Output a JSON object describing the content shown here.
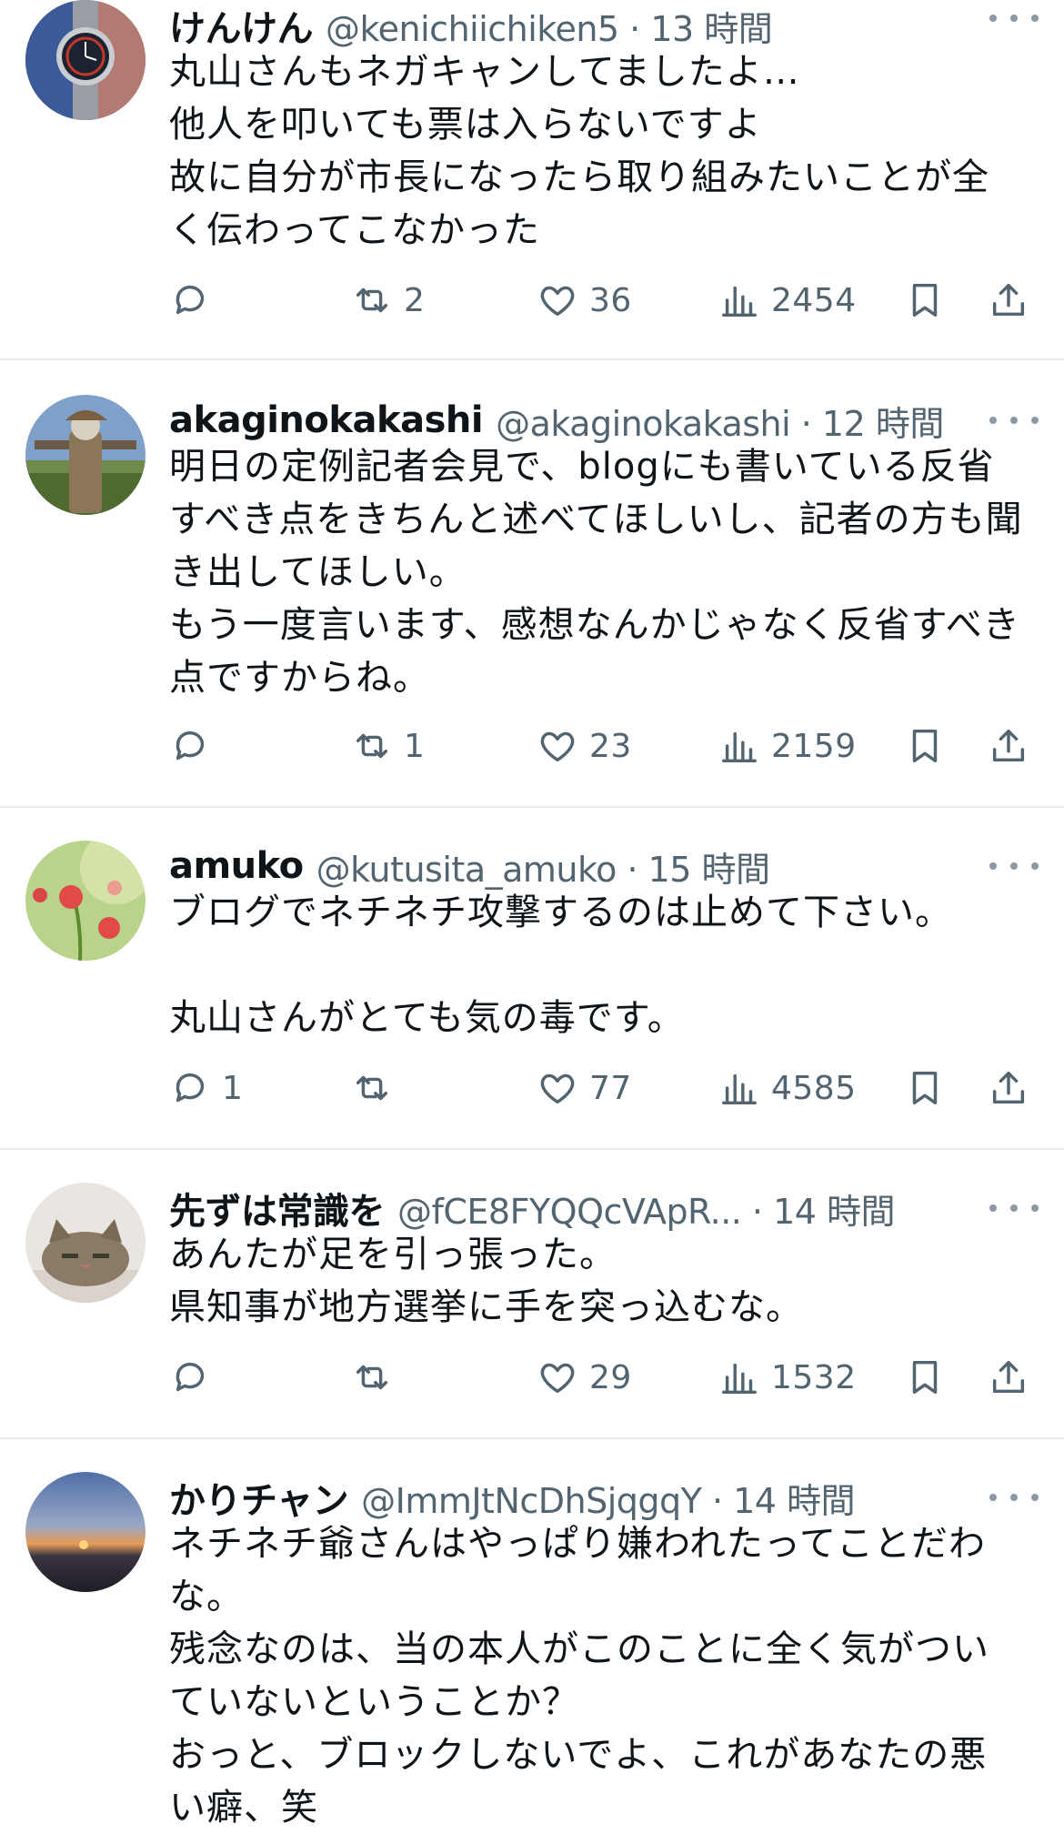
{
  "tweets": [
    {
      "name": "けんけん",
      "handle": "@kenichiichiken5 · 13 時間",
      "avatar": "watch-avatar",
      "body": "丸山さんもネガキャンしてましたよ…\n他人を叩いても票は入らないですよ\n故に自分が市長になったら取り組みたいことが全く伝わってこなかった",
      "replies": "",
      "retweets": "2",
      "likes": "36",
      "views": "2454"
    },
    {
      "name": "akaginokakashi",
      "handle": "@akaginokakashi · 12 時間",
      "avatar": "scarecrow-avatar",
      "body": "明日の定例記者会見で、blogにも書いている反省すべき点をきちんと述べてほしいし、記者の方も聞き出してほしい。\nもう一度言います、感想なんかじゃなく反省すべき点ですからね。",
      "replies": "",
      "retweets": "1",
      "likes": "23",
      "views": "2159"
    },
    {
      "name": "amuko",
      "handle": "@kutusita_amuko · 15 時間",
      "avatar": "flower-avatar",
      "body": "ブログでネチネチ攻撃するのは止めて下さい。\n\n丸山さんがとても気の毒です。",
      "replies": "1",
      "retweets": "",
      "likes": "77",
      "views": "4585"
    },
    {
      "name": "先ずは常識を",
      "handle": "@fCE8FYQQcVApR... · 14 時間",
      "avatar": "cat-avatar",
      "body": "あんたが足を引っ張った。\n県知事が地方選挙に手を突っ込むな。",
      "replies": "",
      "retweets": "",
      "likes": "29",
      "views": "1532"
    },
    {
      "name": "かりチャン",
      "handle": "@ImmJtNcDhSjqgqY · 14 時間",
      "avatar": "sunset-avatar",
      "body": "ネチネチ爺さんはやっぱり嫌われたってことだわな。\n残念なのは、当の本人がこのことに全く気がついていないということか？\nおっと、ブロックしないでよ、これがあなたの悪い癖、笑",
      "replies": "",
      "retweets": "",
      "likes": "",
      "views": ""
    }
  ],
  "colors": {
    "text": "#0f1419",
    "secondary": "#536471",
    "divider": "#e9ebed"
  }
}
